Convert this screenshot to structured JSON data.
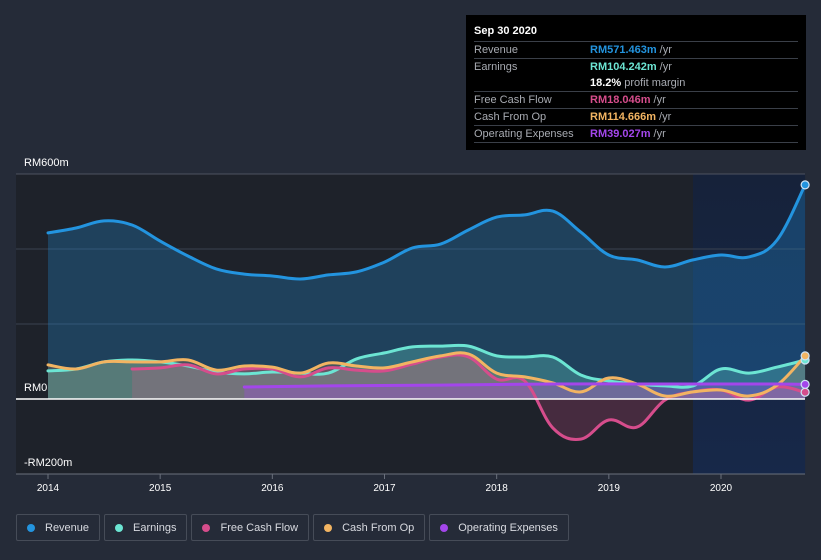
{
  "tooltip": {
    "date": "Sep 30 2020",
    "rows": [
      {
        "label": "Revenue",
        "value": "RM571.463m",
        "unit": "/yr",
        "color": "#2394df"
      },
      {
        "label": "Earnings",
        "value": "RM104.242m",
        "unit": "/yr",
        "color": "#6ce5d3"
      },
      {
        "label": "",
        "value": "18.2%",
        "unit": "profit margin",
        "color": "#ffffff"
      },
      {
        "label": "Free Cash Flow",
        "value": "RM18.046m",
        "unit": "/yr",
        "color": "#d64d8c"
      },
      {
        "label": "Cash From Op",
        "value": "RM114.666m",
        "unit": "/yr",
        "color": "#f2b462"
      },
      {
        "label": "Operating Expenses",
        "value": "RM39.027m",
        "unit": "/yr",
        "color": "#a346eb"
      }
    ]
  },
  "legend": [
    {
      "label": "Revenue",
      "color": "#2394df"
    },
    {
      "label": "Earnings",
      "color": "#6ce5d3"
    },
    {
      "label": "Free Cash Flow",
      "color": "#d64d8c"
    },
    {
      "label": "Cash From Op",
      "color": "#f2b462"
    },
    {
      "label": "Operating Expenses",
      "color": "#a346eb"
    }
  ],
  "chart_data": {
    "type": "area",
    "title": "",
    "xlabel": "",
    "ylabel": "",
    "ylim": [
      -200,
      600
    ],
    "xlim": [
      2013.7,
      2020.75
    ],
    "y_ticks": [
      {
        "value": 600,
        "label": "RM600m"
      },
      {
        "value": 0,
        "label": "RM0"
      },
      {
        "value": -200,
        "label": "-RM200m"
      }
    ],
    "gridlines": [
      600,
      400,
      200,
      0
    ],
    "x_ticks": [
      {
        "value": 2014,
        "label": "2014"
      },
      {
        "value": 2015,
        "label": "2015"
      },
      {
        "value": 2016,
        "label": "2016"
      },
      {
        "value": 2017,
        "label": "2017"
      },
      {
        "value": 2018,
        "label": "2018"
      },
      {
        "value": 2019,
        "label": "2019"
      },
      {
        "value": 2020,
        "label": "2020"
      }
    ],
    "highlight_range": [
      2019.75,
      2020.75
    ],
    "legend_position": "bottom-left",
    "series": [
      {
        "name": "Revenue",
        "color": "#2394df",
        "x": [
          2014.0,
          2014.25,
          2014.5,
          2014.75,
          2015.0,
          2015.25,
          2015.5,
          2015.75,
          2016.0,
          2016.25,
          2016.5,
          2016.75,
          2017.0,
          2017.25,
          2017.5,
          2017.75,
          2018.0,
          2018.25,
          2018.5,
          2018.75,
          2019.0,
          2019.25,
          2019.5,
          2019.75,
          2020.0,
          2020.25,
          2020.5,
          2020.75
        ],
        "values": [
          443,
          456,
          475,
          464,
          421,
          381,
          347,
          333,
          328,
          320,
          331,
          339,
          365,
          403,
          413,
          451,
          485,
          491,
          501,
          445,
          384,
          371,
          352,
          371,
          384,
          379,
          424,
          571
        ]
      },
      {
        "name": "Earnings",
        "color": "#6ce5d3",
        "x": [
          2014.0,
          2014.25,
          2014.5,
          2014.75,
          2015.0,
          2015.25,
          2015.5,
          2015.75,
          2016.0,
          2016.25,
          2016.5,
          2016.75,
          2017.0,
          2017.25,
          2017.5,
          2017.75,
          2018.0,
          2018.25,
          2018.5,
          2018.75,
          2019.0,
          2019.25,
          2019.5,
          2019.75,
          2020.0,
          2020.25,
          2020.5,
          2020.75
        ],
        "values": [
          75,
          80,
          99,
          104,
          99,
          88,
          72,
          67,
          72,
          69,
          69,
          107,
          123,
          139,
          141,
          141,
          115,
          112,
          112,
          64,
          48,
          40,
          35,
          35,
          80,
          69,
          85,
          104
        ]
      },
      {
        "name": "Free Cash Flow",
        "color": "#d64d8c",
        "x": [
          2014.75,
          2015.0,
          2015.25,
          2015.5,
          2015.75,
          2016.0,
          2016.25,
          2016.5,
          2016.75,
          2017.0,
          2017.25,
          2017.5,
          2017.75,
          2018.0,
          2018.25,
          2018.5,
          2018.75,
          2019.0,
          2019.25,
          2019.5,
          2019.75,
          2020.0,
          2020.25,
          2020.5,
          2020.75
        ],
        "values": [
          80,
          83,
          91,
          67,
          80,
          80,
          59,
          83,
          77,
          75,
          93,
          112,
          112,
          53,
          48,
          -77,
          -107,
          -56,
          -75,
          -3,
          19,
          24,
          -3,
          32,
          18
        ]
      },
      {
        "name": "Cash From Op",
        "color": "#f2b462",
        "x": [
          2014.0,
          2014.25,
          2014.5,
          2014.75,
          2015.0,
          2015.25,
          2015.5,
          2015.75,
          2016.0,
          2016.25,
          2016.5,
          2016.75,
          2017.0,
          2017.25,
          2017.5,
          2017.75,
          2018.0,
          2018.25,
          2018.5,
          2018.75,
          2019.0,
          2019.25,
          2019.5,
          2019.75,
          2020.0,
          2020.25,
          2020.5,
          2020.75
        ],
        "values": [
          91,
          80,
          99,
          99,
          99,
          104,
          77,
          88,
          85,
          69,
          96,
          88,
          83,
          99,
          115,
          120,
          69,
          59,
          43,
          19,
          56,
          40,
          8,
          19,
          24,
          8,
          37,
          115
        ]
      },
      {
        "name": "Operating Expenses",
        "color": "#a346eb",
        "x": [
          2015.75,
          2016.5,
          2017.5,
          2018.5,
          2019.5,
          2020.5,
          2020.75
        ],
        "values": [
          32,
          35,
          37,
          40,
          40,
          40,
          39
        ]
      }
    ]
  }
}
